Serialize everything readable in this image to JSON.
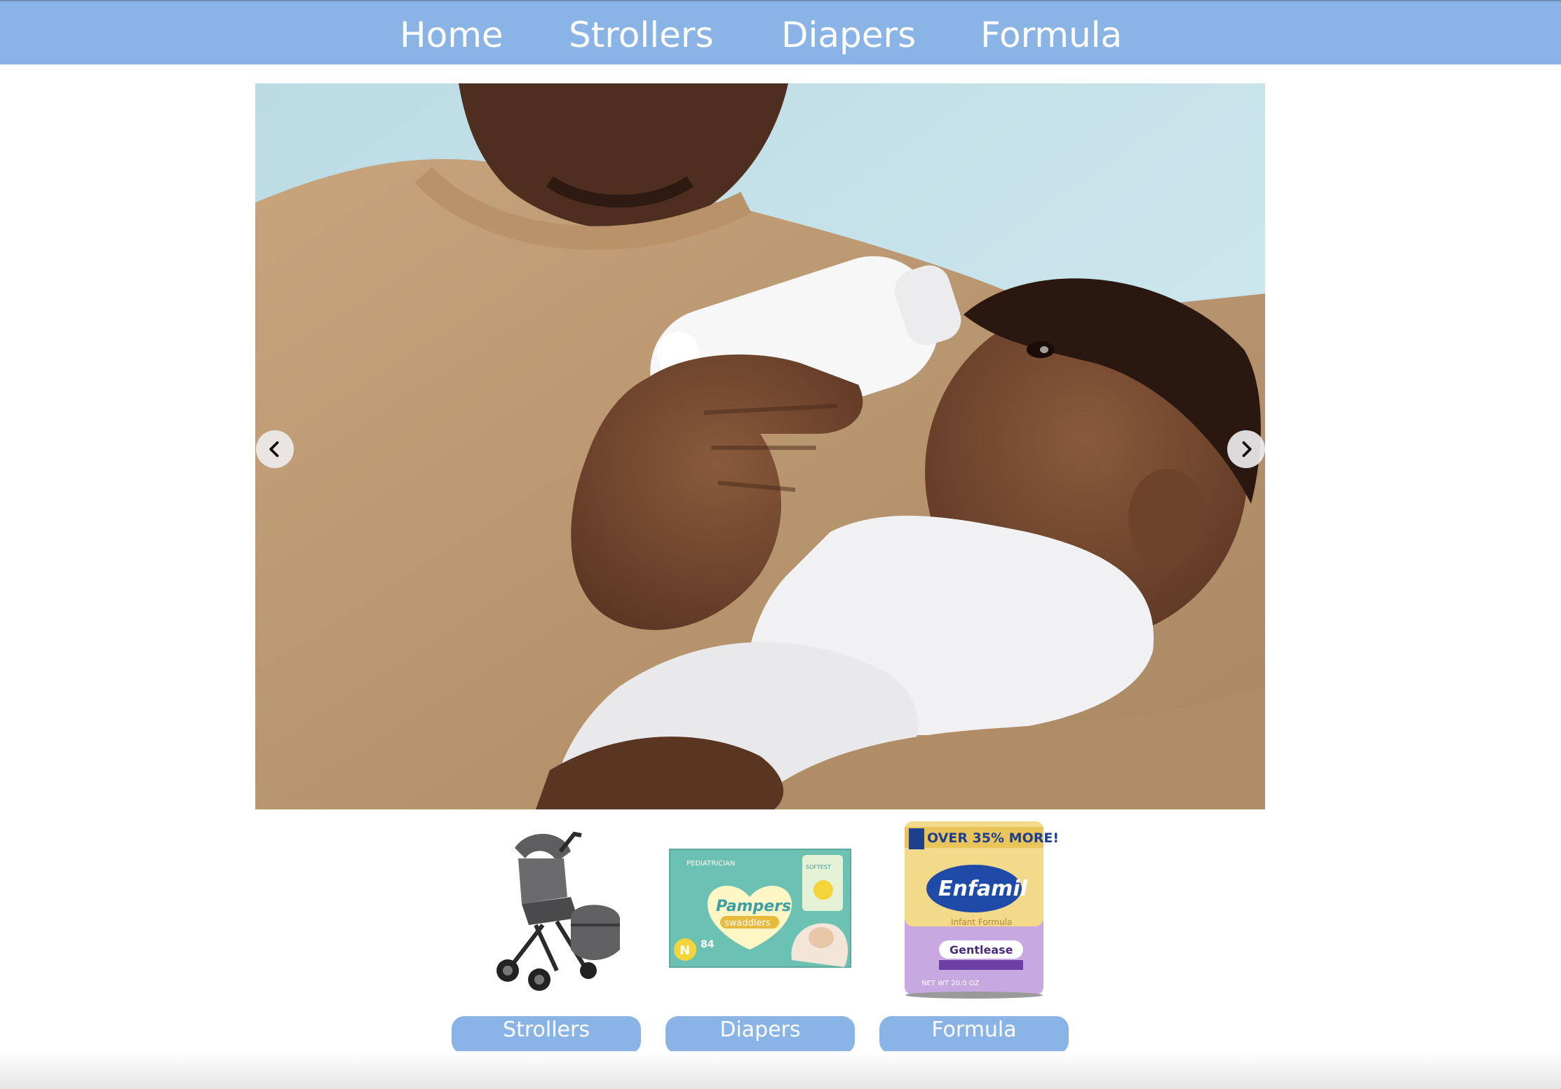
{
  "nav": {
    "items": [
      {
        "label": "Home"
      },
      {
        "label": "Strollers"
      },
      {
        "label": "Diapers"
      },
      {
        "label": "Formula"
      }
    ]
  },
  "carousel": {
    "image": "parent-feeding-baby-bottle-photo",
    "prev_icon": "chevron-left-icon",
    "next_icon": "chevron-right-icon"
  },
  "categories": [
    {
      "label": "Strollers",
      "image": "stroller-product-photo"
    },
    {
      "label": "Diapers",
      "image": "pampers-swaddlers-box-photo",
      "package_text": {
        "top": "PEDIATRICIAN",
        "brand": "Pampers",
        "line": "swaddlers",
        "size": "N",
        "count": "84",
        "badge": "SOFTEST"
      }
    },
    {
      "label": "Formula",
      "image": "enfamil-gentlease-can-photo",
      "package_text": {
        "banner": "OVER 35% MORE!",
        "brand": "Enfamil",
        "sub": "Infant Formula",
        "variant": "Gentlease",
        "net": "NET WT 20.0 OZ"
      }
    }
  ],
  "colors": {
    "nav_bg": "#8ab4e6",
    "button_bg": "#8ab4e6",
    "text_on_accent": "#ffffff"
  }
}
